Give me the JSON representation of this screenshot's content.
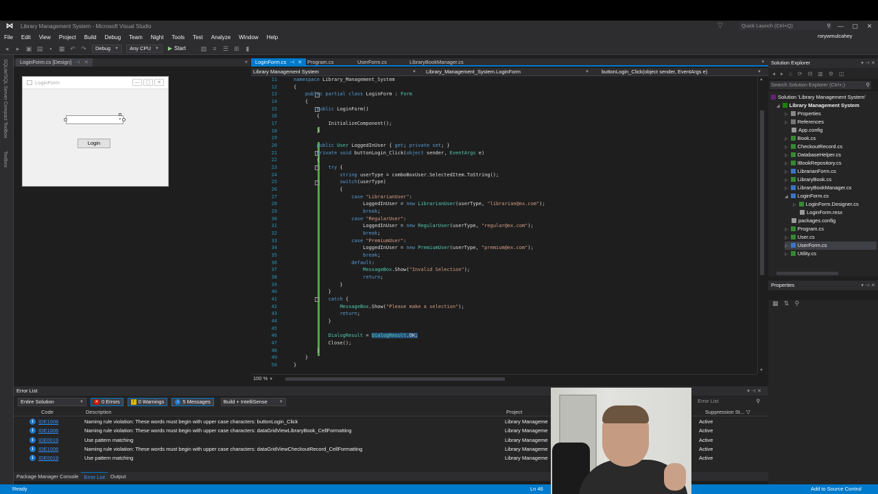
{
  "app": {
    "window_title": "Library Management System - Microsoft Visual Studio",
    "quick_launch": "Quick Launch (Ctrl+Q)",
    "user": "rorywmulcahey"
  },
  "menu": [
    "File",
    "Edit",
    "View",
    "Project",
    "Build",
    "Debug",
    "Team",
    "Night",
    "Tools",
    "Test",
    "Analyze",
    "Window",
    "Help"
  ],
  "toolbar": {
    "config": "Debug",
    "platform": "Any CPU",
    "start": "Start"
  },
  "left_toolwindows": [
    "SQLite/SQL Server Compact Toolbox",
    "Toolbox"
  ],
  "designer": {
    "tab": "LoginForm.cs [Design]",
    "form_title": "LoginForm",
    "button_label": "Login"
  },
  "editor": {
    "tabs": [
      "LoginForm.cs",
      "Program.cs",
      "UserForm.cs",
      "LibraryBookManager.cs"
    ],
    "nav": [
      "Library Management System",
      "Library_Management_System.LoginForm",
      "buttonLogin_Click(object sender, EventArgs e)"
    ],
    "zoom": "100 %",
    "line_numbers": [
      "11",
      "12",
      "13",
      "14",
      "15",
      "16",
      "17",
      "18",
      "19",
      "20",
      "21",
      "22",
      "23",
      "24",
      "25",
      "26",
      "27",
      "28",
      "29",
      "30",
      "31",
      "32",
      "33",
      "34",
      "35",
      "36",
      "37",
      "38",
      "39",
      "40",
      "41",
      "42",
      "43",
      "44",
      "45",
      "46",
      "47",
      "48",
      "49",
      "50"
    ],
    "code": [
      "namespace Library_Management_System",
      "{",
      "    public partial class LoginForm : Form",
      "    {",
      "        public LoginForm()",
      "        {",
      "            InitializeComponent();",
      "        }",
      "",
      "        public User LoggedInUser { get; private set; }",
      "        private void buttonLogin_Click(object sender, EventArgs e)",
      "        {",
      "            try {",
      "                string userType = comboBoxUser.SelectedItem.ToString();",
      "                switch(userType)",
      "                {",
      "                    case \"LibrarianUser\":",
      "                        LoggedInUser = new LibrarianUser(userType, \"librarian@ex.com\");",
      "                        break;",
      "                    case \"RegularUser\":",
      "                        LoggedInUser = new RegularUser(userType, \"regular@ex.com\");",
      "                        break;",
      "                    case \"PremiumUser\":",
      "                        LoggedInUser = new PremiumUser(userType, \"premium@ex.com\");",
      "                        break;",
      "                    default:",
      "                        MessageBox.Show(\"Invalid Selection\");",
      "                        return;",
      "                }",
      "            }",
      "            catch {",
      "                MessageBox.Show(\"Please make a selection\");",
      "                return;",
      "            }",
      "",
      "            DialogResult = DialogResult.OK;",
      "            Close();",
      "        }",
      "    }",
      "}"
    ]
  },
  "solution_explorer": {
    "title": "Solution Explorer",
    "search": "Search Solution Explorer (Ctrl+;)",
    "items": [
      "Solution 'Library Management System'",
      "Library Management System",
      "Properties",
      "References",
      "App.config",
      "Book.cs",
      "CheckoutRecord.cs",
      "DatabaseHelper.cs",
      "IBookRepository.cs",
      "LibrarianForm.cs",
      "LibraryBook.cs",
      "LibraryBookManager.cs",
      "LoginForm.cs",
      "LoginForm.Designer.cs",
      "LoginForm.resx",
      "packages.config",
      "Program.cs",
      "User.cs",
      "UserForm.cs",
      "Utility.cs"
    ]
  },
  "properties": {
    "title": "Properties"
  },
  "error_list": {
    "title": "Error List",
    "scope": "Entire Solution",
    "errors": "0 Errors",
    "warnings": "0 Warnings",
    "messages": "5 Messages",
    "build": "Build + IntelliSense",
    "search": "Error List",
    "columns": [
      "Code",
      "Description",
      "Project",
      "Suppression St..."
    ],
    "rows": [
      {
        "code": "IDE1006",
        "desc": "Naming rule violation: These words must begin with upper case characters: buttonLogin_Click",
        "project": "Library Manageme",
        "state": "Active"
      },
      {
        "code": "IDE1006",
        "desc": "Naming rule violation: These words must begin with upper case characters: dataGridViewLibraryBook_CellFormatting",
        "project": "Library Manageme",
        "state": "Active"
      },
      {
        "code": "IDE0019",
        "desc": "Use pattern matching",
        "project": "Library Manageme",
        "state": "Active"
      },
      {
        "code": "IDE1006",
        "desc": "Naming rule violation: These words must begin with upper case characters: dataGridViewCheckoutRecord_CellFormatting",
        "project": "Library Manageme",
        "state": "Active"
      },
      {
        "code": "IDE0019",
        "desc": "Use pattern matching",
        "project": "Library Manageme",
        "state": "Active"
      }
    ]
  },
  "bottom_tabs": [
    "Package Manager Console",
    "Error List",
    "Output"
  ],
  "status": {
    "ready": "Ready",
    "line": "Ln 46",
    "source": "Add to Source Control"
  }
}
